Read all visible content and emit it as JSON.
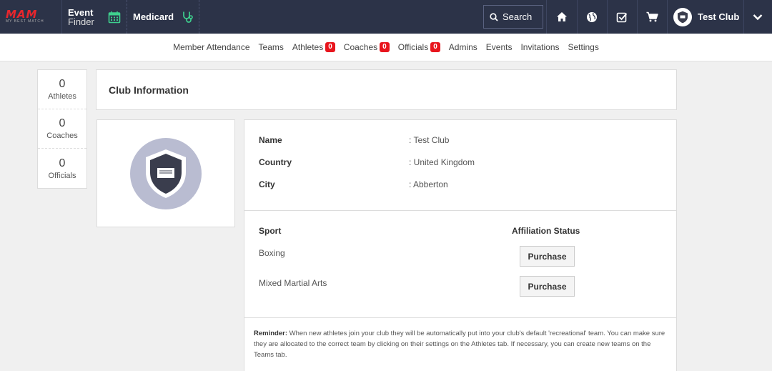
{
  "topbar": {
    "logo_text": "MAM",
    "logo_sub": "MY BEST MATCH",
    "event_finder_line1": "Event",
    "event_finder_line2": "Finder",
    "medicard": "Medicard",
    "search_label": "Search",
    "profile_name": "Test Club",
    "icons": [
      "calendar-icon",
      "stethoscope-icon",
      "search-icon",
      "home-icon",
      "globe-icon",
      "checkbox-icon",
      "cart-icon",
      "chevron-down-icon"
    ]
  },
  "subnav": {
    "member_attendance": "Member Attendance",
    "teams": "Teams",
    "athletes": "Athletes",
    "athletes_count": "0",
    "coaches": "Coaches",
    "coaches_count": "0",
    "officials": "Officials",
    "officials_count": "0",
    "admins": "Admins",
    "events": "Events",
    "invitations": "Invitations",
    "settings": "Settings"
  },
  "stats": [
    {
      "num": "0",
      "label": "Athletes"
    },
    {
      "num": "0",
      "label": "Coaches"
    },
    {
      "num": "0",
      "label": "Officials"
    }
  ],
  "club": {
    "header": "Club Information",
    "fields": [
      {
        "label": "Name",
        "value": ": Test Club"
      },
      {
        "label": "Country",
        "value": ": United Kingdom"
      },
      {
        "label": "City",
        "value": ": Abberton"
      }
    ],
    "sport_header": "Sport",
    "affiliation_header": "Affiliation Status",
    "sports": [
      {
        "name": "Boxing",
        "button": "Purchase"
      },
      {
        "name": "Mixed Martial Arts",
        "button": "Purchase"
      }
    ],
    "reminder_label": "Reminder:",
    "reminder_text": " When new athletes join your club they will be automatically put into your club's default 'recreational' team. You can make sure they are allocated to the correct team by clicking on their settings on the Athletes tab. If necessary, you can create new teams on the Teams tab."
  },
  "colors": {
    "topbar": "#2c3348",
    "accent_green": "#3ecf8e",
    "badge_red": "#e8151d",
    "brand_red": "#e8262d"
  }
}
